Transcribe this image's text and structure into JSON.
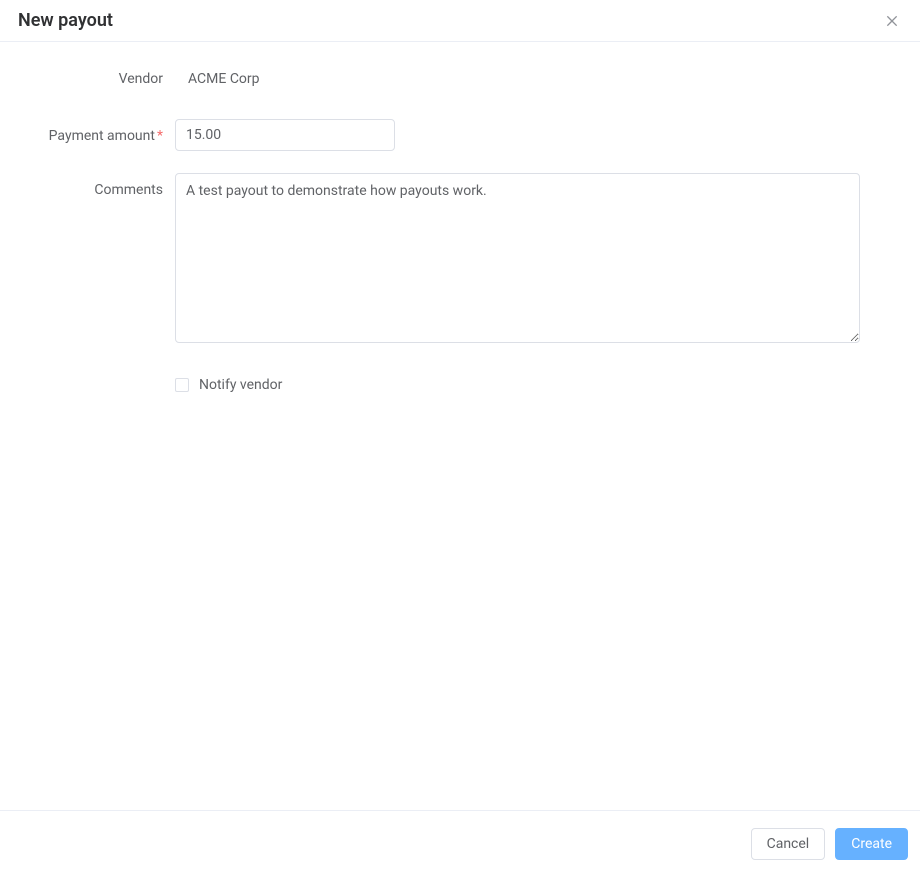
{
  "header": {
    "title": "New payout"
  },
  "form": {
    "vendor_label": "Vendor",
    "vendor_value": "ACME Corp",
    "payment_amount_label": "Payment amount",
    "payment_amount_value": "15.00",
    "comments_label": "Comments",
    "comments_value": "A test payout to demonstrate how payouts work.",
    "notify_vendor_label": "Notify vendor",
    "notify_vendor_checked": false
  },
  "footer": {
    "cancel_label": "Cancel",
    "create_label": "Create"
  }
}
